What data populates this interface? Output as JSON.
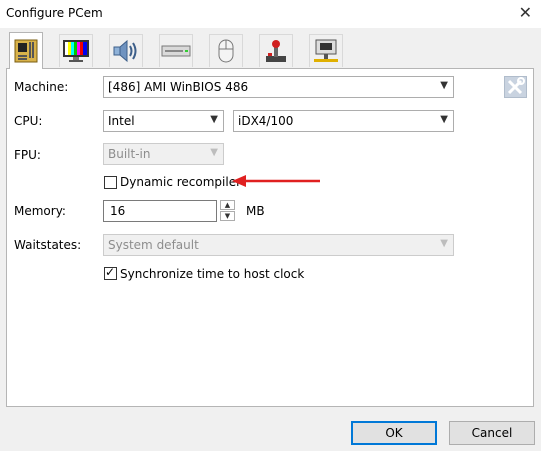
{
  "window": {
    "title": "Configure PCem",
    "close_glyph": "✕"
  },
  "tabs": [
    {
      "icon": "motherboard-icon",
      "active": true
    },
    {
      "icon": "monitor-icon"
    },
    {
      "icon": "speaker-icon"
    },
    {
      "icon": "drive-icon"
    },
    {
      "icon": "mouse-icon"
    },
    {
      "icon": "joystick-icon"
    },
    {
      "icon": "network-icon"
    }
  ],
  "form": {
    "machine_label": "Machine:",
    "machine_value": "[486] AMI WinBIOS 486",
    "cpu_label": "CPU:",
    "cpu_vendor": "Intel",
    "cpu_model": "iDX4/100",
    "fpu_label": "FPU:",
    "fpu_value": "Built-in",
    "dynarec_label": "Dynamic recompiler",
    "dynarec_checked": false,
    "memory_label": "Memory:",
    "memory_value": "16",
    "memory_unit": "MB",
    "waitstates_label": "Waitstates:",
    "waitstates_value": "System default",
    "sync_label": "Synchronize time to host clock",
    "sync_checked": true,
    "check_glyph": "✓",
    "dropdown_glyph": "▼",
    "spin_up_glyph": "▲",
    "spin_down_glyph": "▼"
  },
  "buttons": {
    "ok": "OK",
    "cancel": "Cancel"
  },
  "colors": {
    "annotation_arrow": "#e02020",
    "default_button_border": "#0078d7"
  }
}
